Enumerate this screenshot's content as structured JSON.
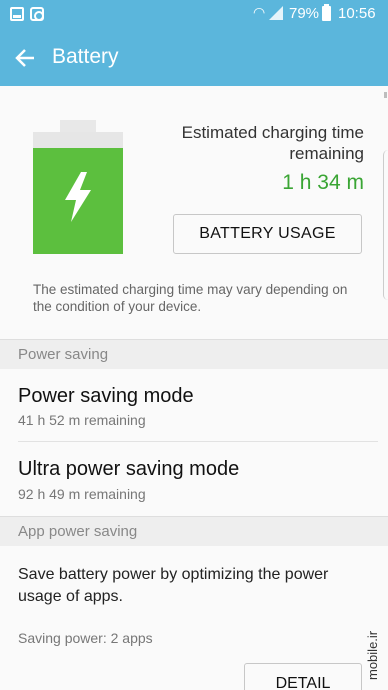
{
  "status_bar": {
    "battery_percent": "79%",
    "time": "10:56"
  },
  "app_bar": {
    "title": "Battery"
  },
  "charging": {
    "estimate_label": "Estimated charging time remaining",
    "estimate_value": "1 h 34 m",
    "usage_button": "BATTERY USAGE",
    "note": "The estimated charging time may vary depending on the condition of your device."
  },
  "power_saving": {
    "header": "Power saving",
    "items": [
      {
        "title": "Power saving mode",
        "subtitle": "41 h 52 m remaining"
      },
      {
        "title": "Ultra power saving mode",
        "subtitle": "92 h 49 m remaining"
      }
    ]
  },
  "app_power_saving": {
    "header": "App power saving",
    "description": "Save battery power by optimizing the power usage of apps.",
    "status": "Saving power: 2 apps",
    "detail_button": "DETAIL"
  },
  "watermark": "mobile.ir",
  "colors": {
    "accent": "#5bb6dc",
    "battery_green": "#5cbf3e",
    "time_green": "#3aa534"
  }
}
